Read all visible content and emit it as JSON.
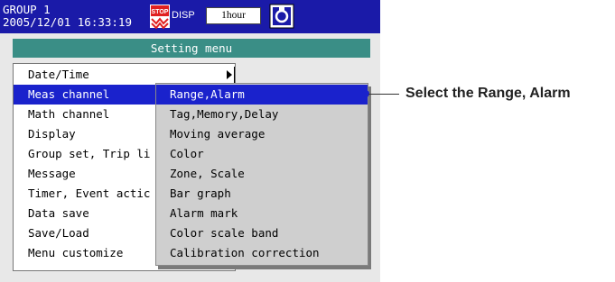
{
  "status": {
    "group": "GROUP 1",
    "datetime": "2005/12/01 16:33:19",
    "stop_badge_icon": "stop-badge-icon",
    "disp_label": "DISP",
    "interval_button": "1hour",
    "media_icon": "cf-card-icon"
  },
  "menu": {
    "title": "Setting menu",
    "items": [
      {
        "label": "Date/Time"
      },
      {
        "label": "Meas channel"
      },
      {
        "label": "Math channel"
      },
      {
        "label": "Display"
      },
      {
        "label": "Group set, Trip li"
      },
      {
        "label": "Message"
      },
      {
        "label": "Timer, Event actic"
      },
      {
        "label": "Data save"
      },
      {
        "label": "Save/Load"
      },
      {
        "label": "Menu customize"
      }
    ],
    "selected_index": 1,
    "submenu_arrow_icon": "triangle-right-icon"
  },
  "submenu": {
    "items": [
      {
        "label": "Range,Alarm"
      },
      {
        "label": "Tag,Memory,Delay"
      },
      {
        "label": "Moving average"
      },
      {
        "label": "Color"
      },
      {
        "label": "Zone, Scale"
      },
      {
        "label": "Bar graph"
      },
      {
        "label": "Alarm mark"
      },
      {
        "label": "Color scale band"
      },
      {
        "label": "Calibration correction"
      }
    ],
    "selected_index": 0
  },
  "annotation": {
    "text": "Select the Range, Alarm"
  },
  "colors": {
    "status_bar": "#1a1aa8",
    "title_bar": "#3a8e86",
    "selection": "#1a22cc",
    "submenu_bg": "#cfcfcf"
  }
}
